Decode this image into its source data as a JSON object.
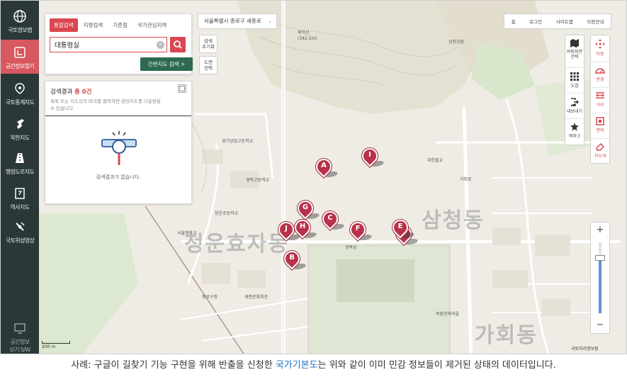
{
  "left_nav": {
    "items": [
      {
        "label": "국토정보맵",
        "icon": "globe-icon"
      },
      {
        "label": "공간정보찾기",
        "icon": "map-search-icon",
        "active": true
      },
      {
        "label": "국토통계지도",
        "icon": "stats-map-icon"
      },
      {
        "label": "북한지도",
        "icon": "north-korea-icon"
      },
      {
        "label": "행정도로지도",
        "icon": "road-icon"
      },
      {
        "label": "역사지도",
        "icon": "history-map-icon"
      },
      {
        "label": "국토위성영상",
        "icon": "satellite-icon"
      }
    ],
    "bottom_label_1": "공간정보",
    "bottom_label_2": "보기 S/W"
  },
  "search": {
    "tabs": [
      "통합검색",
      "지명검색",
      "기준점",
      "국가관심지역"
    ],
    "query": "대통령실",
    "quick_map_button": "간편지도 검색 >"
  },
  "results": {
    "title_prefix": "검색결과",
    "count_text": "총 0건",
    "hint": "목록 또는 지도상의 마크를 클릭하면 관련지도를 다운받을 수 있습니다.",
    "empty_message": "검색결과가 없습니다."
  },
  "address": {
    "value": "서울특별시 종로구 세종로",
    "chevron": "⌄"
  },
  "map_buttons": [
    {
      "line1": "검색",
      "line2": "초기화"
    },
    {
      "line1": "도면",
      "line2": "선택"
    }
  ],
  "top_menu": [
    "홈",
    "로그인",
    "사이트맵",
    "이용안내"
  ],
  "tools_left": [
    {
      "label": "바탕화면 선택",
      "icon": "basemap-icon"
    },
    {
      "label": "도엽",
      "icon": "grid-icon"
    },
    {
      "label": "내보내기",
      "icon": "export-icon"
    },
    {
      "label": "북마크",
      "icon": "star-icon"
    }
  ],
  "tools_right": [
    {
      "label": "이동",
      "icon": "move-icon"
    },
    {
      "label": "반경",
      "icon": "radius-icon"
    },
    {
      "label": "거리",
      "icon": "distance-icon"
    },
    {
      "label": "면적",
      "icon": "area-icon"
    },
    {
      "label": "지우개",
      "icon": "eraser-icon"
    }
  ],
  "zoom": {
    "in": "+",
    "out": "−",
    "level_fraction": 0.78
  },
  "markers": [
    "A",
    "B",
    "C",
    "D",
    "E",
    "F",
    "G",
    "H",
    "I",
    "J"
  ],
  "map_labels": {
    "mountain": "북악산",
    "elev": "(342.5m)",
    "samcheong_park": "삼청공원",
    "school1": "경기상업고등학교",
    "school2": "청운초등학교",
    "school3": "서울맹학교",
    "school4": "경복고등학교",
    "dist1": "삼청동",
    "dist2": "청운효자동",
    "dist3": "가회동",
    "gyeongbok": "경복궁",
    "korea_univ": "대한불교",
    "gaehoe": "가회로",
    "jongno_station": "종로구청",
    "welfare": "세종문화회관",
    "hanok": "북촌한옥마을"
  },
  "scale": "200 m",
  "brand": "국토지리정보원",
  "caption": {
    "before": "사례: 구글이 길찾기 기능 구현을 위해 반출을 신청한 ",
    "link": "국가기본도",
    "after": "는 위와 같이 이미 민감 정보들이 제거된 상태의 데이터입니다."
  }
}
